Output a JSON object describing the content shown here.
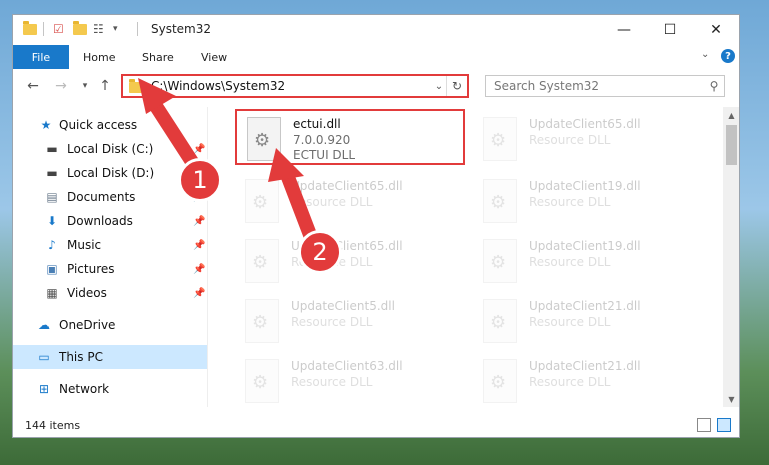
{
  "window": {
    "title": "System32",
    "controls": {
      "minimize": "—",
      "maximize": "☐",
      "close": "✕"
    }
  },
  "ribbon": {
    "tabs": [
      "File",
      "Home",
      "Share",
      "View"
    ],
    "expand_icon": "chevron-down-icon",
    "help": "?"
  },
  "navigation": {
    "back": "←",
    "forward": "→",
    "recent": "▾",
    "up": "↑",
    "address": "C:\\Windows\\System32",
    "search_placeholder": "Search System32"
  },
  "sidebar": {
    "items": [
      {
        "label": "Quick access",
        "icon": "star-icon",
        "pinned": false
      },
      {
        "label": "Local Disk (C:)",
        "icon": "drive-icon",
        "pinned": true
      },
      {
        "label": "Local Disk (D:)",
        "icon": "drive-icon",
        "pinned": false
      },
      {
        "label": "Documents",
        "icon": "documents-icon",
        "pinned": true
      },
      {
        "label": "Downloads",
        "icon": "downloads-icon",
        "pinned": true
      },
      {
        "label": "Music",
        "icon": "music-icon",
        "pinned": true
      },
      {
        "label": "Pictures",
        "icon": "pictures-icon",
        "pinned": true
      },
      {
        "label": "Videos",
        "icon": "videos-icon",
        "pinned": true
      },
      {
        "label": "OneDrive",
        "icon": "cloud-icon",
        "pinned": false
      },
      {
        "label": "This PC",
        "icon": "computer-icon",
        "pinned": false,
        "selected": true
      },
      {
        "label": "Network",
        "icon": "network-icon",
        "pinned": false
      }
    ]
  },
  "files": [
    {
      "name": "ectui.dll",
      "line2": "7.0.0.920",
      "line3": "ECTUI DLL",
      "highlighted": true
    },
    {
      "name": "UpdateClient65.dll",
      "line2": "Resource DLL",
      "line3": ""
    },
    {
      "name": "UpdateClient65.dll",
      "line2": "Resource DLL",
      "line3": ""
    },
    {
      "name": "UpdateClient19.dll",
      "line2": "Resource DLL",
      "line3": ""
    },
    {
      "name": "UpdateClient65.dll",
      "line2": "Resource DLL",
      "line3": ""
    },
    {
      "name": "UpdateClient19.dll",
      "line2": "Resource DLL",
      "line3": ""
    },
    {
      "name": "UpdateClient5.dll",
      "line2": "Resource DLL",
      "line3": ""
    },
    {
      "name": "UpdateClient21.dll",
      "line2": "Resource DLL",
      "line3": ""
    },
    {
      "name": "UpdateClient63.dll",
      "line2": "Resource DLL",
      "line3": ""
    },
    {
      "name": "UpdateClient21.dll",
      "line2": "Resource DLL",
      "line3": ""
    }
  ],
  "status": {
    "item_count": "144 items"
  },
  "annotations": {
    "step1": "1",
    "step2": "2"
  },
  "colors": {
    "accent": "#1979ca",
    "highlight": "#e23b3b",
    "selection": "#cce8ff"
  }
}
